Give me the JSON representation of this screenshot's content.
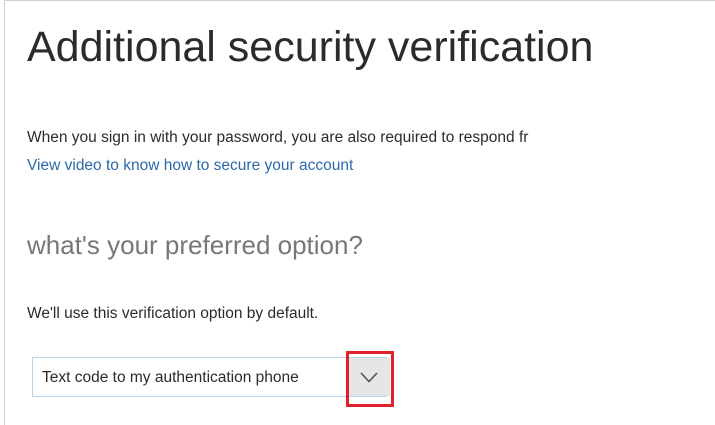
{
  "page": {
    "title": "Additional security verification",
    "intro_text": "When you sign in with your password, you are also required to respond fr",
    "video_link": "View video to know how to secure your account"
  },
  "preferred_option": {
    "heading": "what's your preferred option?",
    "helper_text": "We'll use this verification option by default.",
    "select": {
      "selected_value": "Text code to my authentication phone",
      "icon": "chevron-down-icon"
    }
  },
  "colors": {
    "link": "#2a6aa8",
    "heading_gray": "#777777",
    "select_border": "#b9d3ea",
    "dropdown_button_bg": "#e6e6e6",
    "highlight": "#e0202a"
  }
}
